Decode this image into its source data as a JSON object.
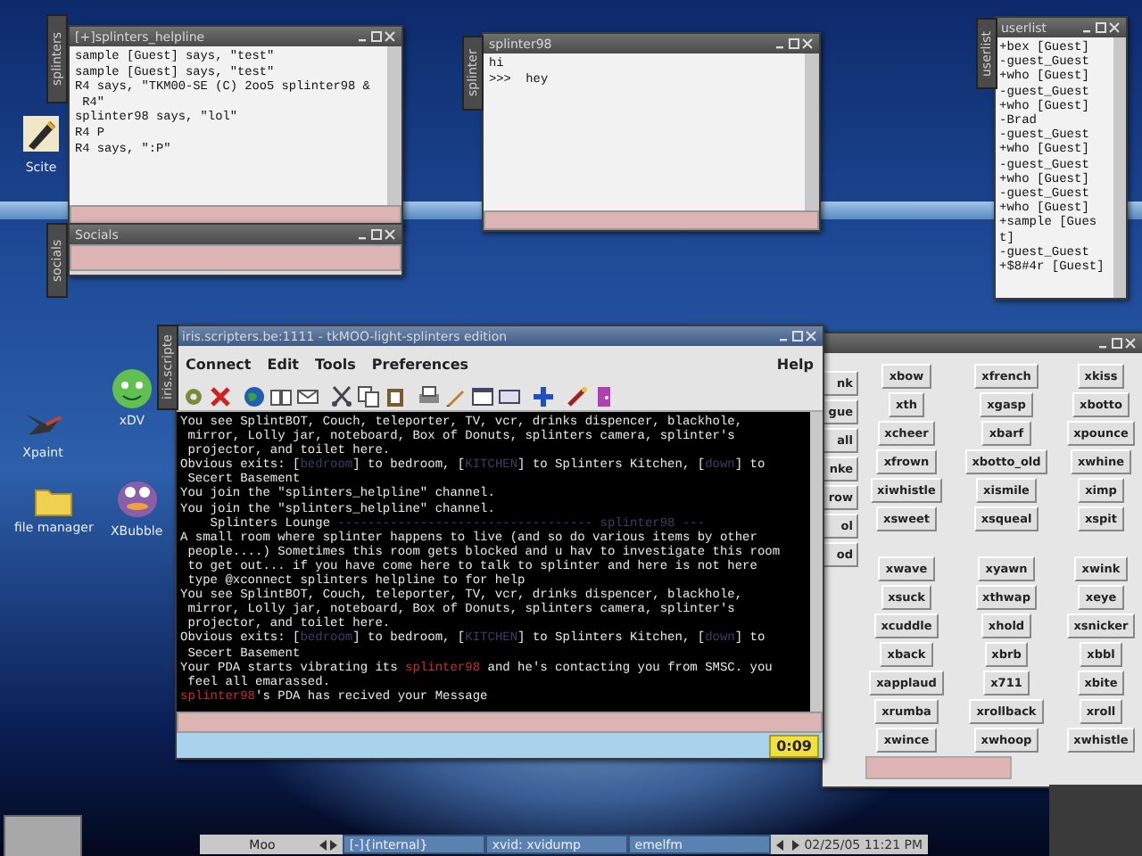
{
  "desktop_icons": [
    {
      "kind": "pen",
      "label": "Scite"
    },
    {
      "kind": "bird",
      "label": "Xpaint"
    },
    {
      "kind": "folder",
      "label": "file manager"
    },
    {
      "kind": "face",
      "label": "xDV"
    },
    {
      "kind": "creature",
      "label": "XBubble"
    }
  ],
  "helpline_window": {
    "title": "[+]splinters_helpline",
    "side_tab": "splinters",
    "lines": [
      "sample [Guest] says, \"test\"",
      "sample [Guest] says, \"test\"",
      "R4 says, \"TKM00-SE (C) 2oo5 splinter98 &",
      " R4\"",
      "splinter98 says, \"lol\"",
      "R4 P",
      "R4 says, \":P\""
    ]
  },
  "socials_window": {
    "title": "Socials",
    "side_tab": "socials"
  },
  "private_window": {
    "title": "splinter98",
    "side_tab": "splinter",
    "lines": [
      "hi",
      ">>>  hey"
    ]
  },
  "userlist_window": {
    "title": "userlist",
    "side_tab": "userlist",
    "users": [
      "+bex [Guest]",
      "-guest_Guest",
      "+who [Guest]",
      "-guest_Guest",
      "+who [Guest]",
      "-Brad",
      "-guest_Guest",
      "+who [Guest]",
      "-guest_Guest",
      "+who [Guest]",
      "-guest_Guest",
      "+who [Guest]",
      "+sample [Guest]",
      "-guest_Guest",
      "+$8#4r [Guest]"
    ]
  },
  "socials_buttons_window": {
    "partial_buttons": [
      {
        "label": "nk"
      },
      {
        "label": "gue"
      },
      {
        "label": "all"
      },
      {
        "label": "nke"
      },
      {
        "label": "row"
      },
      {
        "label": "ol"
      },
      {
        "label": "od"
      }
    ],
    "groups": [
      [
        "xbow",
        "xfrench",
        "xkiss",
        "xth",
        "xgasp",
        "xbotto",
        "xcheer",
        "xbarf",
        "xpounce",
        "xfrown",
        "xbotto_old",
        "xwhine",
        "xiwhistle",
        "xismile",
        "ximp",
        "xsweet",
        "xsqueal",
        "xspit"
      ],
      [
        "xwave",
        "xyawn",
        "xwink",
        "xsuck",
        "xthwap",
        "xeye",
        "xcuddle",
        "xhold",
        "xsnicker",
        "xback",
        "xbrb",
        "xbbl",
        "xapplaud",
        "x711",
        "xbite",
        "xrumba",
        "xrollback",
        "xroll",
        "xwince",
        "xwhoop",
        "xwhistle"
      ]
    ]
  },
  "main_window": {
    "title": "iris.scripters.be:1111 - tkMOO-light-splinters edition",
    "side_tab": "iris.scripte",
    "menu": [
      "Connect",
      "Edit",
      "Tools",
      "Preferences"
    ],
    "help_menu": "Help",
    "output": [
      [
        {
          "kind": "plain",
          "text": "You see SplintBOT, Couch, teleporter, TV, vcr, drinks dispencer, blackhole,"
        }
      ],
      [
        {
          "kind": "plain",
          "text": " mirror, Lolly jar, noteboard, Box of Donuts, splinters camera, splinter's"
        }
      ],
      [
        {
          "kind": "plain",
          "text": " projector, and toilet here."
        }
      ],
      [
        {
          "kind": "plain",
          "text": "Obvious exits: ["
        },
        {
          "kind": "exit",
          "text": "bedroom"
        },
        {
          "kind": "plain",
          "text": "] to bedroom, ["
        },
        {
          "kind": "exit",
          "text": "KITCHEN"
        },
        {
          "kind": "plain",
          "text": "] to Splinters Kitchen, ["
        },
        {
          "kind": "exit",
          "text": "down"
        },
        {
          "kind": "plain",
          "text": "] to"
        }
      ],
      [
        {
          "kind": "plain",
          "text": " Secert Basement"
        }
      ],
      [
        {
          "kind": "plain",
          "text": "You join the \"splinters_helpline\" channel."
        }
      ],
      [
        {
          "kind": "plain",
          "text": "You join the \"splinters_helpline\" channel."
        }
      ],
      [
        {
          "kind": "plain",
          "text": "    Splinters Lounge "
        },
        {
          "kind": "exit",
          "text": "---------------------------------- splinter98 ---"
        }
      ],
      [
        {
          "kind": "plain",
          "text": "A small room where splinter happens to live (and so do various items by other"
        }
      ],
      [
        {
          "kind": "plain",
          "text": " people....) Sometimes this room gets blocked and u hav to investigate this room"
        }
      ],
      [
        {
          "kind": "plain",
          "text": " to get out... if you have come here to talk to splinter and here is not here"
        }
      ],
      [
        {
          "kind": "plain",
          "text": " type @xconnect splinters helpline to for help"
        }
      ],
      [
        {
          "kind": "plain",
          "text": "You see SplintBOT, Couch, teleporter, TV, vcr, drinks dispencer, blackhole,"
        }
      ],
      [
        {
          "kind": "plain",
          "text": " mirror, Lolly jar, noteboard, Box of Donuts, splinters camera, splinter's"
        }
      ],
      [
        {
          "kind": "plain",
          "text": " projector, and toilet here."
        }
      ],
      [
        {
          "kind": "plain",
          "text": "Obvious exits: ["
        },
        {
          "kind": "exit",
          "text": "bedroom"
        },
        {
          "kind": "plain",
          "text": "] to bedroom, ["
        },
        {
          "kind": "exit",
          "text": "KITCHEN"
        },
        {
          "kind": "plain",
          "text": "] to Splinters Kitchen, ["
        },
        {
          "kind": "exit",
          "text": "down"
        },
        {
          "kind": "plain",
          "text": "] to"
        }
      ],
      [
        {
          "kind": "plain",
          "text": " Secert Basement"
        }
      ],
      [
        {
          "kind": "plain",
          "text": "Your PDA starts vibrating its "
        },
        {
          "kind": "player",
          "text": "splinter98"
        },
        {
          "kind": "plain",
          "text": " and he's contacting you from SMSC. you"
        }
      ],
      [
        {
          "kind": "plain",
          "text": " feel all emarassed."
        }
      ],
      [
        {
          "kind": "player",
          "text": "splinter98"
        },
        {
          "kind": "plain",
          "text": "'s PDA has recived your Message"
        }
      ]
    ],
    "timer": "0:09"
  },
  "taskbar": {
    "workspace": "Moo",
    "tasks": [
      "[-]{internal}",
      "xvid: xvidump",
      "emelfm"
    ],
    "clock": "02/25/05 11:21 PM"
  }
}
